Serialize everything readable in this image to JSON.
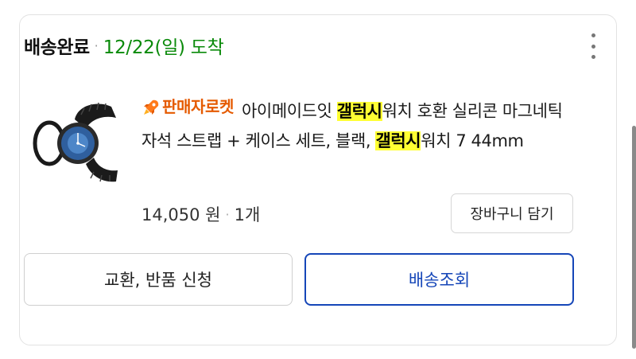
{
  "order": {
    "status": "배송완료",
    "separator": "·",
    "arrival": "12/22(일) 도착"
  },
  "product": {
    "badge": "판매자로켓",
    "title_part1": "아이메이드잇 ",
    "highlight1": "갤럭시",
    "title_part2": "워치 호환 실리콘 마그네틱 자석 스트랩 + 케이스 세트, 블랙, ",
    "highlight2": "갤럭시",
    "title_part3": "워치 7 44mm",
    "price": "14,050 원",
    "price_separator": "·",
    "quantity": "1개"
  },
  "buttons": {
    "cart": "장바구니 담기",
    "exchange": "교환, 반품 신청",
    "tracking": "배송조회"
  },
  "icons": {
    "more": "more-vertical-icon",
    "badge": "rocket-icon"
  },
  "colors": {
    "arrival": "#0a8a0a",
    "badge": "#e55a00",
    "highlight": "#ffff33",
    "tracking": "#1546b8"
  }
}
